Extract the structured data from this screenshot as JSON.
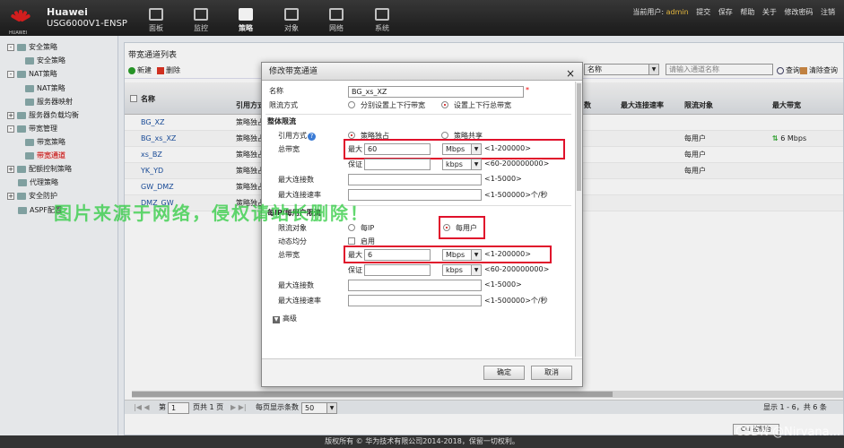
{
  "header": {
    "logo_text": "HUAWEI",
    "brand": "Huawei",
    "model": "USG6000V1-ENSP",
    "nav": [
      "面板",
      "监控",
      "策略",
      "对象",
      "网络",
      "系统"
    ],
    "active_nav": "策略",
    "current_user_label": "当前用户:",
    "current_user": "admin",
    "actions": [
      "提交",
      "保存",
      "帮助",
      "关于",
      "修改密码",
      "注销"
    ]
  },
  "sidebar": {
    "items": [
      {
        "label": "安全策略",
        "level": 0,
        "toggle": "-"
      },
      {
        "label": "安全策略",
        "level": 1
      },
      {
        "label": "NAT策略",
        "level": 0,
        "toggle": "-"
      },
      {
        "label": "NAT策略",
        "level": 1
      },
      {
        "label": "服务器映射",
        "level": 1
      },
      {
        "label": "服务器负载均衡",
        "level": 0,
        "toggle": "+"
      },
      {
        "label": "带宽管理",
        "level": 0,
        "toggle": "-"
      },
      {
        "label": "带宽策略",
        "level": 1
      },
      {
        "label": "带宽通道",
        "level": 1,
        "selected": true
      },
      {
        "label": "配额控制策略",
        "level": 0,
        "toggle": "+"
      },
      {
        "label": "代理策略",
        "level": 0
      },
      {
        "label": "安全防护",
        "level": 0,
        "toggle": "+"
      },
      {
        "label": "ASPF配置",
        "level": 0
      }
    ]
  },
  "main": {
    "title": "带宽通道列表",
    "new_label": "新建",
    "delete_label": "删除",
    "filter_select": "名称",
    "search_placeholder": "请输入通道名称",
    "query_label": "查询",
    "clear_label": "清除查询",
    "columns": [
      "名称",
      "引用方式",
      "数",
      "最大连接速率",
      "限流对象",
      "最大带宽"
    ],
    "rows": [
      {
        "name": "BG_XZ",
        "ref": "策略独占",
        "target": "",
        "bw": ""
      },
      {
        "name": "BG_xs_XZ",
        "ref": "策略独占",
        "target": "每用户",
        "bw": "6 Mbps"
      },
      {
        "name": "xs_BZ",
        "ref": "策略独占",
        "target": "每用户",
        "bw": ""
      },
      {
        "name": "YK_YD",
        "ref": "策略独占",
        "target": "每用户",
        "bw": ""
      },
      {
        "name": "GW_DMZ",
        "ref": "策略独占",
        "target": "",
        "bw": ""
      },
      {
        "name": "DMZ_GW",
        "ref": "策略独占",
        "target": "",
        "bw": ""
      }
    ],
    "pager": {
      "page_prefix": "第",
      "page": "1",
      "page_suffix": "页共 1 页",
      "per_page_label": "每页显示条数",
      "per_page": "50",
      "summary": "显示 1 - 6，共 6 条"
    },
    "cli_label": "CLI 控制台"
  },
  "dialog": {
    "title": "修改带宽通道",
    "name_label": "名称",
    "name_value": "BG_xs_XZ",
    "mode_label": "限流方式",
    "mode_opt1": "分别设置上下行带宽",
    "mode_opt2": "设置上下行总带宽",
    "overall_section": "整体限流",
    "ref_label": "引用方式",
    "ref_opt1": "策略独占",
    "ref_opt2": "策略共享",
    "total_bw_label": "总带宽",
    "max_label": "最大",
    "max_value": "60",
    "unit_mbps": "Mbps",
    "range_max": "<1-200000>",
    "guarantee_label": "保证",
    "unit_kbps": "kbps",
    "range_guar": "<60-200000000>",
    "max_conn_label": "最大连接数",
    "range_conn": "<1-5000>",
    "max_rate_label": "最大连接速率",
    "range_rate": "<1-500000>个/秒",
    "per_section": "每IP/每用户限流",
    "target_label": "限流对象",
    "target_opt1": "每IP",
    "target_opt2": "每用户",
    "dyn_label": "动态均分",
    "enable_label": "启用",
    "per_total_label": "总带宽",
    "per_max_value": "6",
    "per_range_guar": "<60-200000000>",
    "advanced_label": "高级",
    "ok_label": "确定",
    "cancel_label": "取消"
  },
  "watermark": "图片来源于网络，侵权请站长删除！",
  "footer": "版权所有 © 华为技术有限公司2014-2018，保留一切权利。",
  "corner_mark": "CSDN @Nirvana..."
}
